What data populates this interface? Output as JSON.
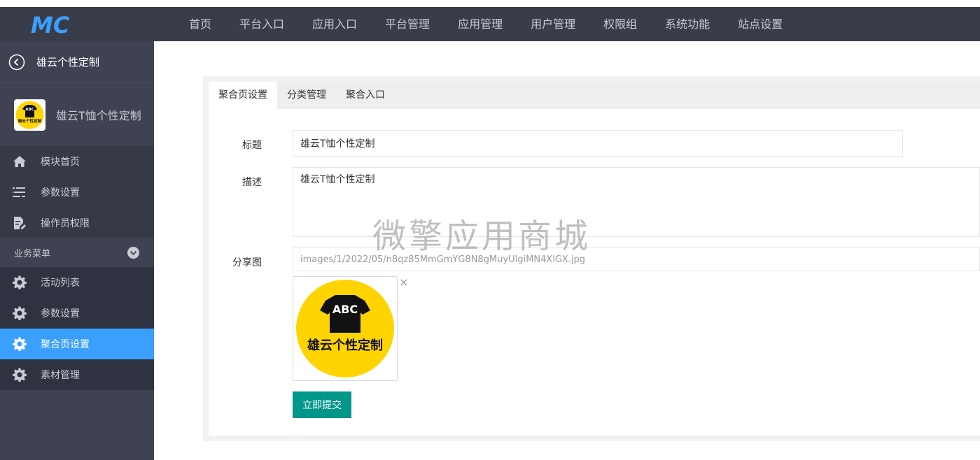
{
  "header": {
    "logo_text": "MC",
    "nav": [
      "首页",
      "平台入口",
      "应用入口",
      "平台管理",
      "应用管理",
      "用户管理",
      "权限组",
      "系统功能",
      "站点设置"
    ]
  },
  "sidebar": {
    "back_title": "雄云个性定制",
    "app_name": "雄云T恤个性定制",
    "app_logo_text": "ABC",
    "app_logo_caption": "雄云个性定制",
    "menu": [
      {
        "label": "模块首页",
        "icon": "home-icon"
      },
      {
        "label": "参数设置",
        "icon": "sliders-icon"
      },
      {
        "label": "操作员权限",
        "icon": "edit-doc-icon"
      }
    ],
    "group_title": "业务菜单",
    "group_items": [
      {
        "label": "活动列表",
        "icon": "gear-icon"
      },
      {
        "label": "参数设置",
        "icon": "gear-icon"
      },
      {
        "label": "聚合页设置",
        "icon": "gear-icon",
        "active": true
      },
      {
        "label": "素材管理",
        "icon": "gear-icon"
      }
    ]
  },
  "main": {
    "tabs": [
      "聚合页设置",
      "分类管理",
      "聚合入口"
    ],
    "active_tab": 0,
    "form": {
      "title_label": "标题",
      "title_value": "雄云T恤个性定制",
      "desc_label": "描述",
      "desc_value": "雄云T恤个性定制",
      "share_label": "分享图",
      "share_value": "images/1/2022/05/n8qz85MmGmYG8N8gMuyUlgiMN4XlGX.jpg",
      "image_text": "ABC",
      "image_caption": "雄云个性定制",
      "remove_symbol": "×",
      "submit_label": "立即提交"
    }
  },
  "watermark": "微擎应用商城",
  "colors": {
    "header_bg": "#393d49",
    "sidebar_bg": "#3f4252",
    "active_item": "#3a9fff",
    "submit_button": "#009688",
    "logo_yellow": "#ffd400"
  }
}
